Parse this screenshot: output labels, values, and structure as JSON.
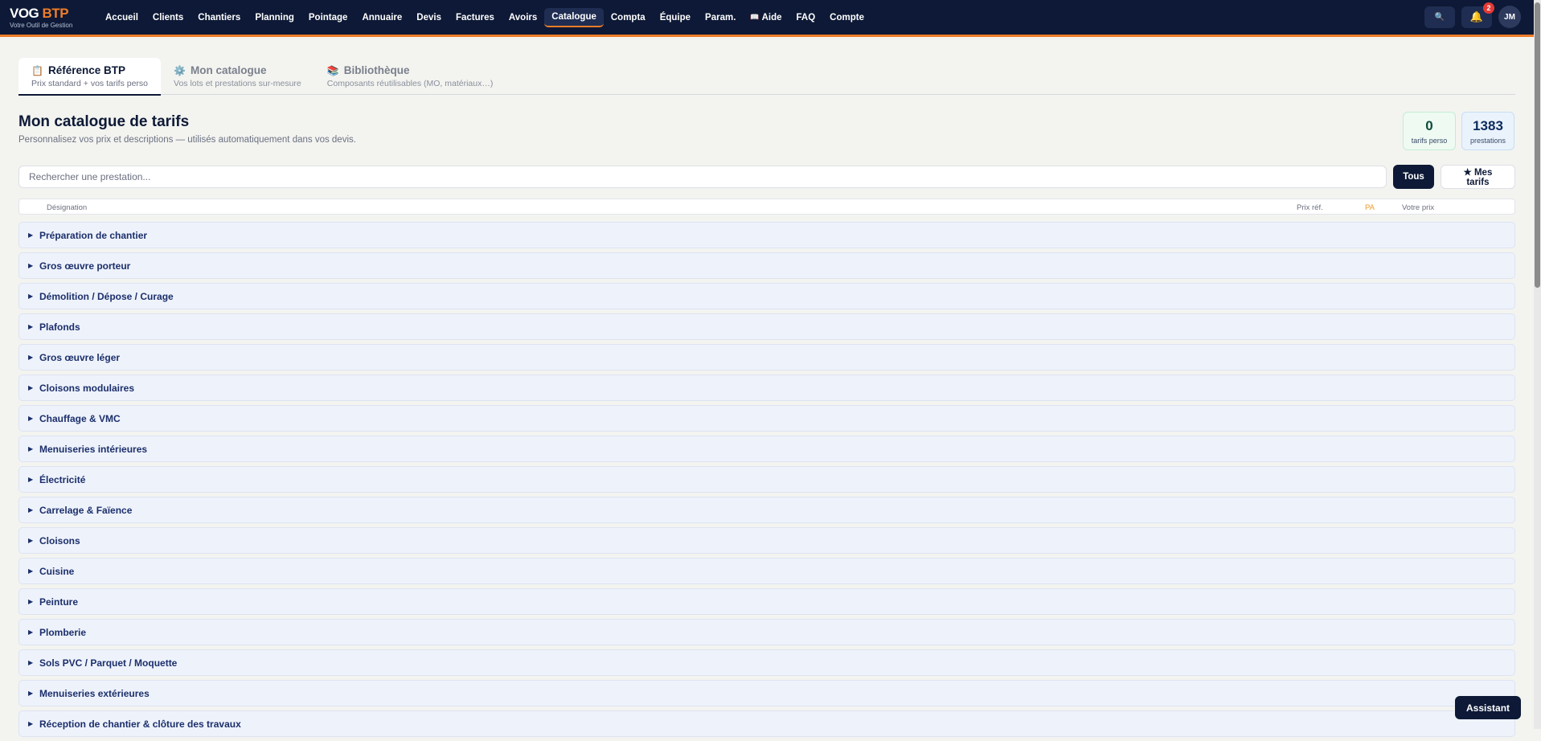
{
  "brand": {
    "name_main": "VOG",
    "name_accent": "BTP",
    "tagline": "Votre Outil de Gestion"
  },
  "nav": {
    "items": [
      {
        "label": "Accueil",
        "active": false
      },
      {
        "label": "Clients",
        "active": false
      },
      {
        "label": "Chantiers",
        "active": false
      },
      {
        "label": "Planning",
        "active": false
      },
      {
        "label": "Pointage",
        "active": false
      },
      {
        "label": "Annuaire",
        "active": false
      },
      {
        "label": "Devis",
        "active": false
      },
      {
        "label": "Factures",
        "active": false
      },
      {
        "label": "Avoirs",
        "active": false
      },
      {
        "label": "Catalogue",
        "active": true
      },
      {
        "label": "Compta",
        "active": false
      },
      {
        "label": "Équipe",
        "active": false
      },
      {
        "label": "Param.",
        "active": false
      },
      {
        "label": "Aide",
        "active": false,
        "icon": "book-icon",
        "icon_glyph": "📖"
      },
      {
        "label": "FAQ",
        "active": false
      },
      {
        "label": "Compte",
        "active": false
      }
    ],
    "search_icon": "🔍",
    "bell_icon": "🔔",
    "notification_count": "2",
    "avatar_initials": "JM"
  },
  "tabs": [
    {
      "icon_glyph": "📋",
      "title": "Référence BTP",
      "subtitle": "Prix standard + vos tarifs perso",
      "active": true
    },
    {
      "icon_glyph": "⚙️",
      "title": "Mon catalogue",
      "subtitle": "Vos lots et prestations sur-mesure",
      "active": false
    },
    {
      "icon_glyph": "📚",
      "title": "Bibliothèque",
      "subtitle": "Composants réutilisables (MO, matériaux…)",
      "active": false
    }
  ],
  "page": {
    "title": "Mon catalogue de tarifs",
    "subtitle": "Personnalisez vos prix et descriptions — utilisés automatiquement dans vos devis."
  },
  "stats": {
    "custom": {
      "value": "0",
      "label": "tarifs perso"
    },
    "total": {
      "value": "1383",
      "label": "prestations"
    }
  },
  "search": {
    "placeholder": "Rechercher une prestation...",
    "filter_all": "Tous",
    "filter_mine": "★ Mes tarifs"
  },
  "table": {
    "headers": {
      "designation": "Désignation",
      "ref_price": "Prix réf.",
      "pa": "PA",
      "your_price": "Votre prix"
    }
  },
  "categories": [
    "Préparation de chantier",
    "Gros œuvre porteur",
    "Démolition / Dépose / Curage",
    "Plafonds",
    "Gros œuvre léger",
    "Cloisons modulaires",
    "Chauffage & VMC",
    "Menuiseries intérieures",
    "Électricité",
    "Carrelage & Faïence",
    "Cloisons",
    "Cuisine",
    "Peinture",
    "Plomberie",
    "Sols PVC / Parquet / Moquette",
    "Menuiseries extérieures",
    "Réception de chantier & clôture des travaux"
  ],
  "assistant": {
    "label": "Assistant"
  },
  "colors": {
    "nav_bg": "#0d1936",
    "accent": "#ef7d2a",
    "category_bg": "#eef2fb",
    "category_text": "#1b2f6b"
  }
}
